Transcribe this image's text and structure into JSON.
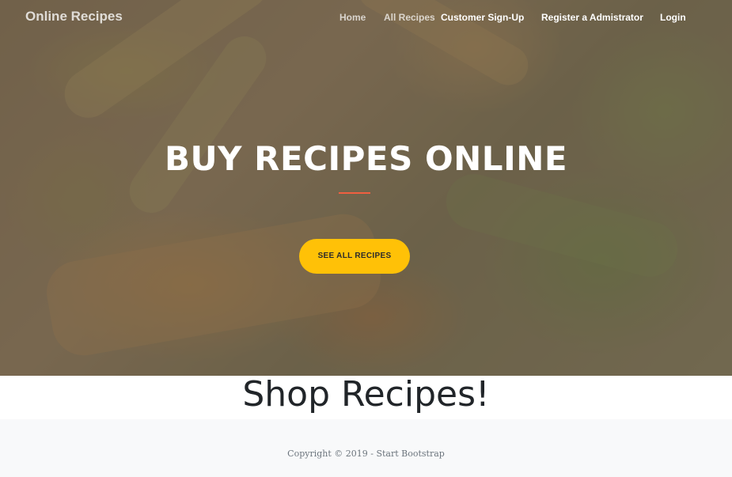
{
  "navbar": {
    "brand": "Online Recipes",
    "links": [
      {
        "label": "Home"
      },
      {
        "label": "All Recipes"
      },
      {
        "label": "Customer Sign-Up"
      },
      {
        "label": "Register a Admistrator"
      },
      {
        "label": "Login"
      }
    ]
  },
  "hero": {
    "title": "BUY RECIPES ONLINE",
    "cta_label": "SEE ALL RECIPES",
    "divider_color": "#f05f40",
    "cta_color": "#ffc107"
  },
  "shop": {
    "heading": "Shop Recipes!"
  },
  "footer": {
    "copyright": "Copyright © 2019 - Start Bootstrap"
  }
}
